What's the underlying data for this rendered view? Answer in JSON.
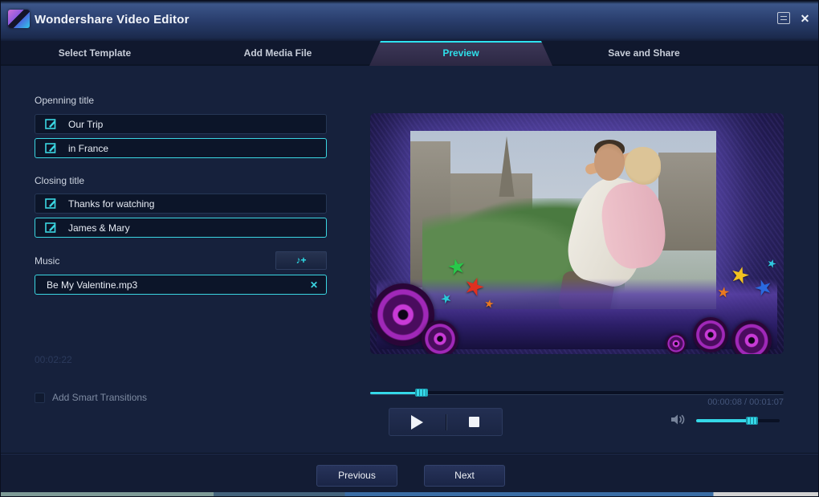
{
  "titlebar": {
    "title": "Wondershare Video Editor",
    "close_glyph": "✕"
  },
  "tabs": [
    {
      "label": "Select Template",
      "active": false
    },
    {
      "label": "Add Media File",
      "active": false
    },
    {
      "label": "Preview",
      "active": true
    },
    {
      "label": "Save and Share",
      "active": false
    }
  ],
  "panel": {
    "opening_label": "Openning title",
    "opening_field_1": "Our Trip",
    "opening_field_2": "in France",
    "closing_label": "Closing title",
    "closing_field_1": "Thanks for watching",
    "closing_field_2": "James & Mary",
    "music_label": "Music",
    "music_add_glyph": "♪+",
    "music_file": "Be My Valentine.mp3",
    "clear_glyph": "✕",
    "duration": "00:02:22",
    "transitions_label": "Add Smart Transitions",
    "transitions_checked": false
  },
  "player": {
    "progress_percent": 12.5,
    "time_display": "00:00:08 / 00:01:07",
    "volume_percent": 66
  },
  "footer": {
    "previous": "Previous",
    "next": "Next"
  },
  "decor": {
    "star_glyph": "★"
  },
  "colors": {
    "accent": "#2ee0ea",
    "selected_border": "#3bd6e2",
    "content_bg": "#16213c",
    "frame_purple": "#41337e",
    "speaker_purple": "#a028b8"
  }
}
